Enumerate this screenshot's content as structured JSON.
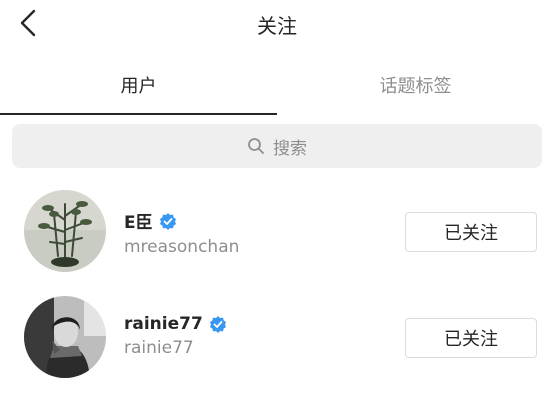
{
  "header": {
    "title": "关注"
  },
  "tabs": [
    {
      "label": "用户"
    },
    {
      "label": "话题标签"
    }
  ],
  "search": {
    "placeholder": "搜索"
  },
  "users": [
    {
      "username": "E臣",
      "fullname": "mreasonchan",
      "button": "已关注",
      "verified": true
    },
    {
      "username": "rainie77",
      "fullname": "rainie77",
      "button": "已关注",
      "verified": true
    }
  ],
  "colors": {
    "verified": "#3897f0",
    "secondary_text": "#8e8e8e",
    "search_bg": "#efefef"
  }
}
